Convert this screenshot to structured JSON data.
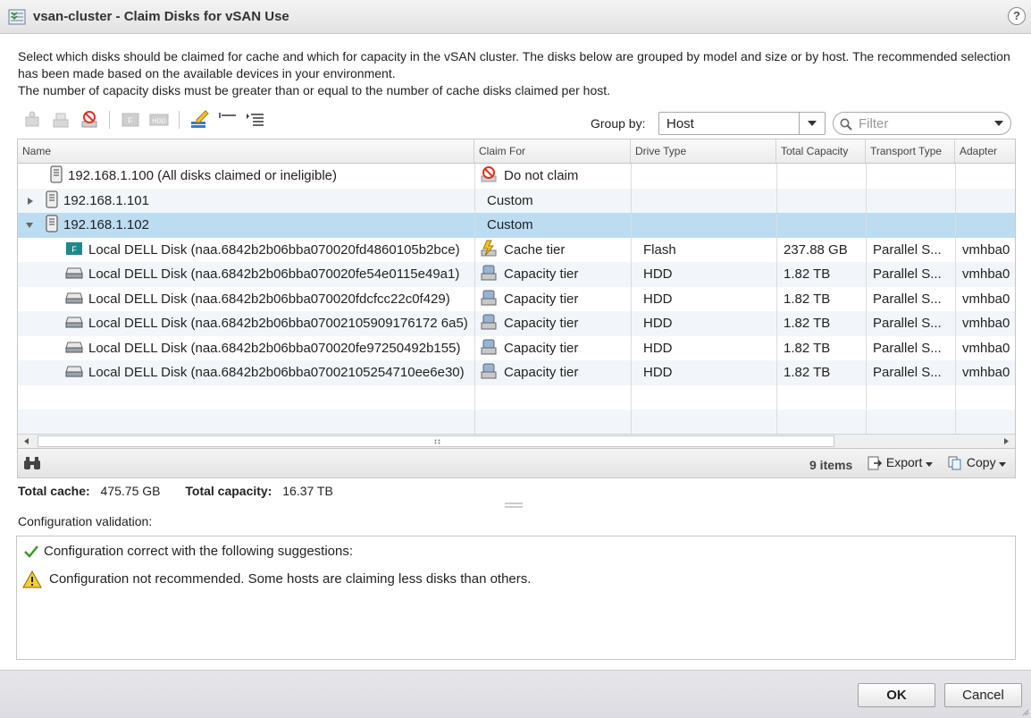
{
  "window": {
    "title": "vsan-cluster - Claim Disks for vSAN Use",
    "help_label": "?"
  },
  "description": {
    "line1": "Select which disks should be claimed for cache and which for capacity in the vSAN cluster. The disks below are grouped by model and size or by host. The recommended selection has been made based on the available devices in your environment.",
    "line2": "The number of capacity disks must be greater than or equal to the number of cache disks claimed per host."
  },
  "toolbar": {
    "hdd_label": "HDD",
    "flash_label": "F"
  },
  "group_by": {
    "label": "Group by:",
    "value": "Host"
  },
  "filter": {
    "placeholder": "Filter"
  },
  "table": {
    "columns": [
      "Name",
      "Claim For",
      "Drive Type",
      "Total Capacity",
      "Transport Type",
      "Adapter"
    ],
    "rows": [
      {
        "name": "192.168.1.100 (All disks claimed or ineligible)",
        "claim": "Do not claim",
        "drive": "",
        "capacity": "",
        "transport": "",
        "adapter": ""
      },
      {
        "name": "192.168.1.101",
        "claim": "Custom",
        "drive": "",
        "capacity": "",
        "transport": "",
        "adapter": ""
      },
      {
        "name": "192.168.1.102",
        "claim": "Custom",
        "drive": "",
        "capacity": "",
        "transport": "",
        "adapter": ""
      },
      {
        "name": "Local DELL Disk (naa.6842b2b06bba070020fd4860105b2bce)",
        "claim": "Cache tier",
        "drive": "Flash",
        "capacity": "237.88 GB",
        "transport": "Parallel S...",
        "adapter": "vmhba0"
      },
      {
        "name": "Local DELL Disk (naa.6842b2b06bba070020fe54e0115e49a1)",
        "claim": "Capacity tier",
        "drive": "HDD",
        "capacity": "1.82 TB",
        "transport": "Parallel S...",
        "adapter": "vmhba0"
      },
      {
        "name": "Local DELL Disk (naa.6842b2b06bba070020fdcfcc22c0f429)",
        "claim": "Capacity tier",
        "drive": "HDD",
        "capacity": "1.82 TB",
        "transport": "Parallel S...",
        "adapter": "vmhba0"
      },
      {
        "name": "Local DELL Disk (naa.6842b2b06bba07002105909176172 6a5)",
        "claim": "Capacity tier",
        "drive": "HDD",
        "capacity": "1.82 TB",
        "transport": "Parallel S...",
        "adapter": "vmhba0"
      },
      {
        "name": "Local DELL Disk (naa.6842b2b06bba070020fe97250492b155)",
        "claim": "Capacity tier",
        "drive": "HDD",
        "capacity": "1.82 TB",
        "transport": "Parallel S...",
        "adapter": "vmhba0"
      },
      {
        "name": "Local DELL Disk (naa.6842b2b06bba07002105254710ee6e30)",
        "claim": "Capacity tier",
        "drive": "HDD",
        "capacity": "1.82 TB",
        "transport": "Parallel S...",
        "adapter": "vmhba0"
      }
    ]
  },
  "footer": {
    "items": "9 items",
    "export_label": "Export",
    "copy_label": "Copy"
  },
  "totals": {
    "cache_label": "Total cache:",
    "cache_value": "475.75 GB",
    "capacity_label": "Total capacity:",
    "capacity_value": "16.37 TB"
  },
  "validation": {
    "label": "Configuration validation:",
    "success": "Configuration correct with the following suggestions:",
    "warning": "Configuration not recommended. Some hosts are claiming less disks than others."
  },
  "buttons": {
    "ok": "OK",
    "cancel": "Cancel"
  }
}
